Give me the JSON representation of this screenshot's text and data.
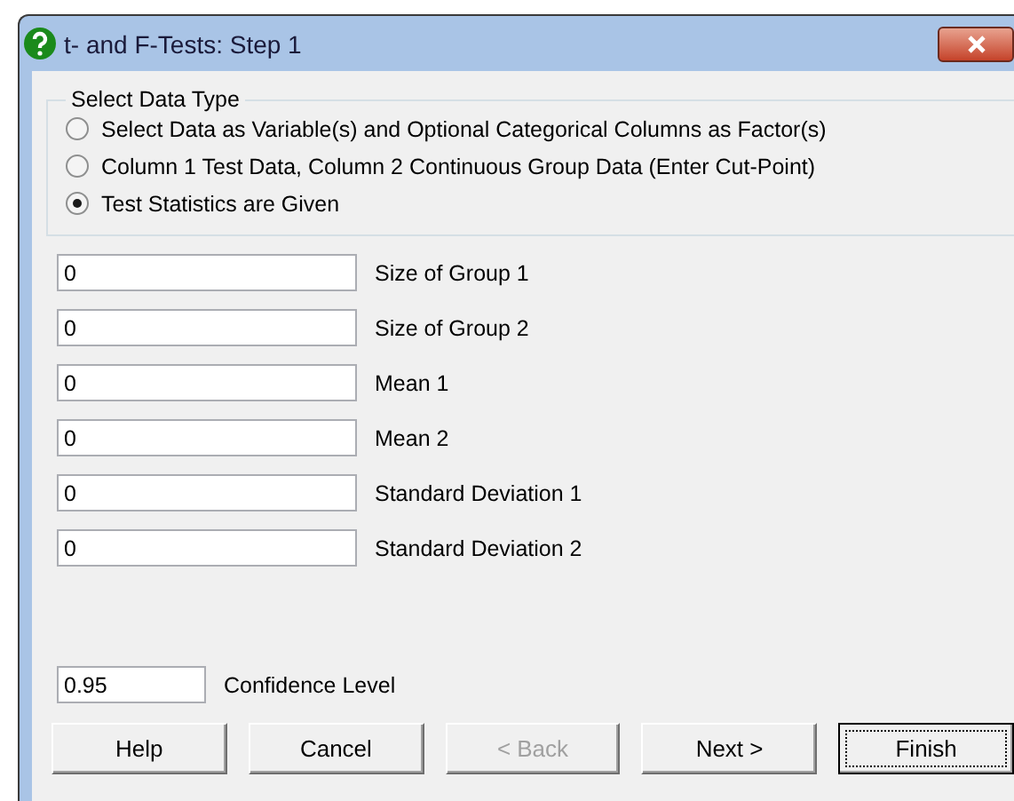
{
  "window": {
    "title": "t- and F-Tests: Step 1"
  },
  "data_type": {
    "title": "Select Data Type",
    "options": [
      {
        "label": "Select Data as Variable(s) and Optional Categorical Columns as Factor(s)",
        "selected": false
      },
      {
        "label": "Column 1 Test Data, Column 2 Continuous Group Data (Enter Cut-Point)",
        "selected": false
      },
      {
        "label": "Test Statistics are Given",
        "selected": true
      }
    ]
  },
  "fields": [
    {
      "value": "0",
      "label": "Size of Group 1"
    },
    {
      "value": "0",
      "label": "Size of Group 2"
    },
    {
      "value": "0",
      "label": "Mean 1"
    },
    {
      "value": "0",
      "label": "Mean 2"
    },
    {
      "value": "0",
      "label": "Standard Deviation 1"
    },
    {
      "value": "0",
      "label": "Standard Deviation 2"
    }
  ],
  "confidence": {
    "value": "0.95",
    "label": "Confidence Level"
  },
  "buttons": [
    {
      "label": "Help",
      "disabled": false,
      "focused": false
    },
    {
      "label": "Cancel",
      "disabled": false,
      "focused": false
    },
    {
      "label": "< Back",
      "disabled": true,
      "focused": false
    },
    {
      "label": "Next >",
      "disabled": false,
      "focused": false
    },
    {
      "label": "Finish",
      "disabled": false,
      "focused": true
    }
  ]
}
